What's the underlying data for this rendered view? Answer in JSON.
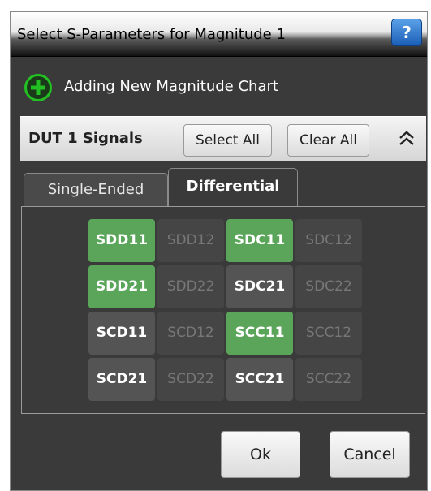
{
  "dialog": {
    "title": "Select S-Parameters for Magnitude 1",
    "help_label": "?",
    "add_chart_label": "Adding New Magnitude Chart",
    "icon_add": "plus-circle-icon",
    "icon_collapse": "double-chevron-up-icon"
  },
  "dut": {
    "label": "DUT 1 Signals",
    "select_all_label": "Select All",
    "clear_all_label": "Clear All"
  },
  "tabs": [
    {
      "label": "Single-Ended",
      "active": false
    },
    {
      "label": "Differential",
      "active": true
    }
  ],
  "colors": {
    "selected_green": "#5aa55a",
    "dialog_bg": "#3a3a3a",
    "add_icon_green": "#22c022"
  },
  "params": [
    [
      {
        "label": "SDD11",
        "state": "selected"
      },
      {
        "label": "SDD12",
        "state": "disabled"
      },
      {
        "label": "SDC11",
        "state": "selected"
      },
      {
        "label": "SDC12",
        "state": "disabled"
      }
    ],
    [
      {
        "label": "SDD21",
        "state": "selected"
      },
      {
        "label": "SDD22",
        "state": "disabled"
      },
      {
        "label": "SDC21",
        "state": "enabled"
      },
      {
        "label": "SDC22",
        "state": "disabled"
      }
    ],
    [
      {
        "label": "SCD11",
        "state": "enabled"
      },
      {
        "label": "SCD12",
        "state": "disabled"
      },
      {
        "label": "SCC11",
        "state": "selected"
      },
      {
        "label": "SCC12",
        "state": "disabled"
      }
    ],
    [
      {
        "label": "SCD21",
        "state": "enabled"
      },
      {
        "label": "SCD22",
        "state": "disabled"
      },
      {
        "label": "SCC21",
        "state": "enabled"
      },
      {
        "label": "SCC22",
        "state": "disabled"
      }
    ]
  ],
  "footer": {
    "ok_label": "Ok",
    "cancel_label": "Cancel"
  }
}
